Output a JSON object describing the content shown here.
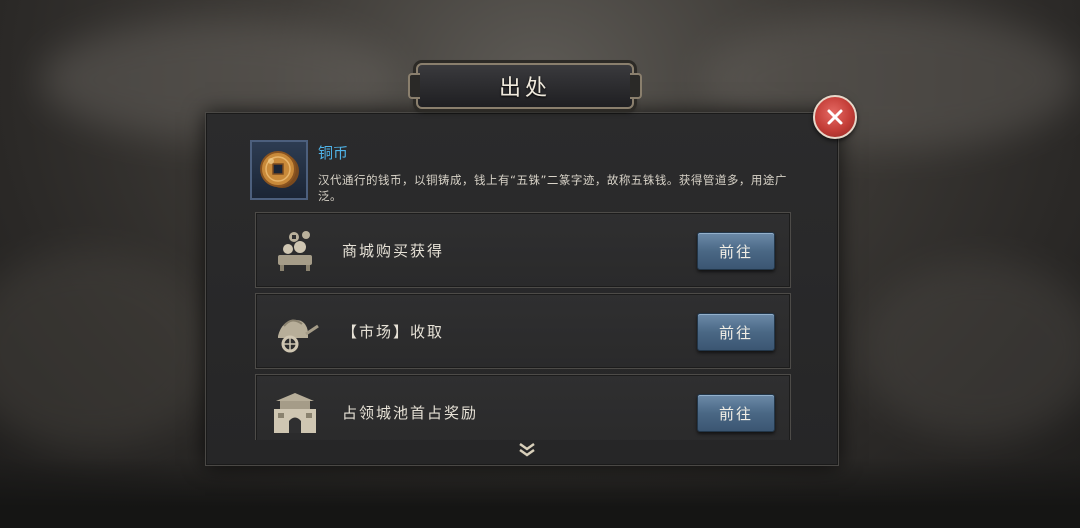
{
  "dialog": {
    "title": "出处",
    "item": {
      "name": "铜币",
      "description": "汉代通行的钱币，以铜铸成，钱上有“五铢”二篆字迹，故称五铢钱。获得管道多，用途广泛。",
      "icon": "copper-coin-icon"
    },
    "sources": [
      {
        "label": "商城购买获得",
        "icon": "shop-coins-icon",
        "button": "前往"
      },
      {
        "label": "【市场】收取",
        "icon": "market-cart-icon",
        "button": "前往"
      },
      {
        "label": "占领城池首占奖励",
        "icon": "city-gate-icon",
        "button": "前往"
      }
    ],
    "more_icon": "double-chevron-down-icon",
    "close_icon": "close-icon"
  },
  "colors": {
    "item_name": "#4fb3e8",
    "button": "#4a6885",
    "close": "#c33d37"
  }
}
